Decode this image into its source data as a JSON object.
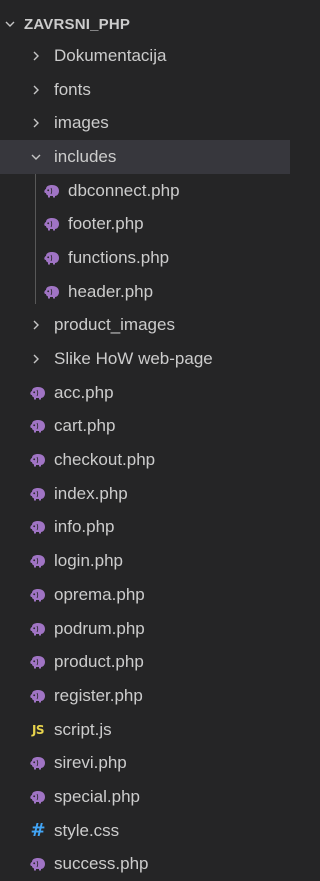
{
  "explorer": {
    "root_label": "ZAVRSNI_PHP",
    "items": [
      {
        "label": "Dokumentacija",
        "kind": "folder",
        "state": "collapsed",
        "depth": 1
      },
      {
        "label": "fonts",
        "kind": "folder",
        "state": "collapsed",
        "depth": 1
      },
      {
        "label": "images",
        "kind": "folder",
        "state": "collapsed",
        "depth": 1
      },
      {
        "label": "includes",
        "kind": "folder",
        "state": "expanded",
        "depth": 1,
        "selected": true
      },
      {
        "label": "dbconnect.php",
        "kind": "php",
        "depth": 2
      },
      {
        "label": "footer.php",
        "kind": "php",
        "depth": 2
      },
      {
        "label": "functions.php",
        "kind": "php",
        "depth": 2
      },
      {
        "label": "header.php",
        "kind": "php",
        "depth": 2
      },
      {
        "label": "product_images",
        "kind": "folder",
        "state": "collapsed",
        "depth": 1
      },
      {
        "label": "Slike HoW web-page",
        "kind": "folder",
        "state": "collapsed",
        "depth": 1
      },
      {
        "label": "acc.php",
        "kind": "php",
        "depth": 1
      },
      {
        "label": "cart.php",
        "kind": "php",
        "depth": 1
      },
      {
        "label": "checkout.php",
        "kind": "php",
        "depth": 1
      },
      {
        "label": "index.php",
        "kind": "php",
        "depth": 1
      },
      {
        "label": "info.php",
        "kind": "php",
        "depth": 1
      },
      {
        "label": "login.php",
        "kind": "php",
        "depth": 1
      },
      {
        "label": "oprema.php",
        "kind": "php",
        "depth": 1
      },
      {
        "label": "podrum.php",
        "kind": "php",
        "depth": 1
      },
      {
        "label": "product.php",
        "kind": "php",
        "depth": 1
      },
      {
        "label": "register.php",
        "kind": "php",
        "depth": 1
      },
      {
        "label": "script.js",
        "kind": "js",
        "depth": 1
      },
      {
        "label": "sirevi.php",
        "kind": "php",
        "depth": 1
      },
      {
        "label": "special.php",
        "kind": "php",
        "depth": 1
      },
      {
        "label": "style.css",
        "kind": "css",
        "depth": 1
      },
      {
        "label": "success.php",
        "kind": "php",
        "depth": 1
      }
    ],
    "icons": {
      "php": "php-elephant-icon",
      "js": "js-file-icon",
      "css": "css-hash-icon",
      "folder_collapsed": "chevron-right-icon",
      "folder_expanded": "chevron-down-icon"
    },
    "icon_text": {
      "js": "JS",
      "css": "#"
    }
  },
  "colors": {
    "background": "#252526",
    "selected_row": "#37373d",
    "text": "#cccccc",
    "php_icon": "#a074c4",
    "js_icon": "#e8d44d",
    "css_icon": "#42a5f5"
  }
}
